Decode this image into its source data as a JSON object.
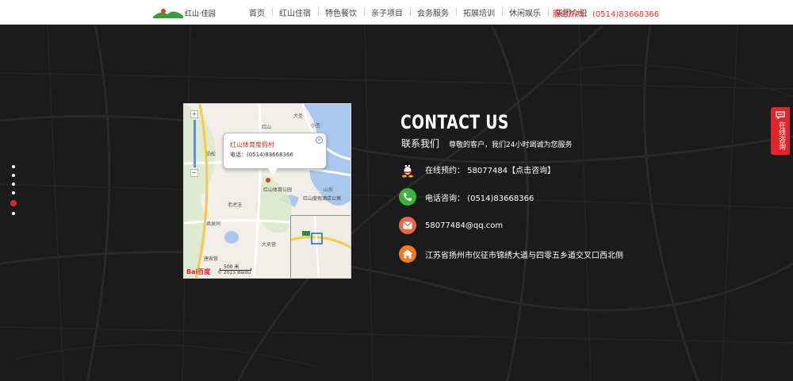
{
  "header": {
    "logo_text": "红山·佳园",
    "nav": [
      "首页",
      "红山住宿",
      "特色餐饮",
      "亲子项目",
      "会务服务",
      "拓展培训",
      "休闲娱乐",
      "集团介绍"
    ],
    "hotline": "服务热线：(0514)83668366"
  },
  "map": {
    "popup_title": "红山体育度假村",
    "popup_phone": "电话：(0514)83668366",
    "labels": [
      "大圣",
      "红山",
      "小圣",
      "红山体育公园",
      "红山度假酒店公寓",
      "老虎洼",
      "君泉同",
      "大吴营",
      "唐家营",
      "山后",
      "泊松"
    ],
    "scale": "500 米",
    "baidu_logo": "Bai百度",
    "baidu_copy": "© 2015 Baidu"
  },
  "contact": {
    "title": "CONTACT US",
    "subtitle": "联系我们",
    "description": "尊敬的客户，我们24小时竭诚为您服务",
    "items": [
      {
        "icon": "qq-icon",
        "text": "在线预约： 58077484【点击咨询】",
        "color": "#ffffff"
      },
      {
        "icon": "phone-icon",
        "text": "电话咨询： (0514)83668366",
        "color": "#3db23a"
      },
      {
        "icon": "mail-icon",
        "text": "58077484@qq.com",
        "color": "#e4684a"
      },
      {
        "icon": "home-icon",
        "text": "江苏省扬州市仪征市锦绣大道与四零五乡道交叉口西北侧",
        "color": "#f07a23"
      }
    ]
  },
  "consult_tab": {
    "label": "在线咨询"
  },
  "colors": {
    "accent": "#e0262c",
    "hotline": "#e33b2d",
    "background": "#1b1b1b"
  }
}
